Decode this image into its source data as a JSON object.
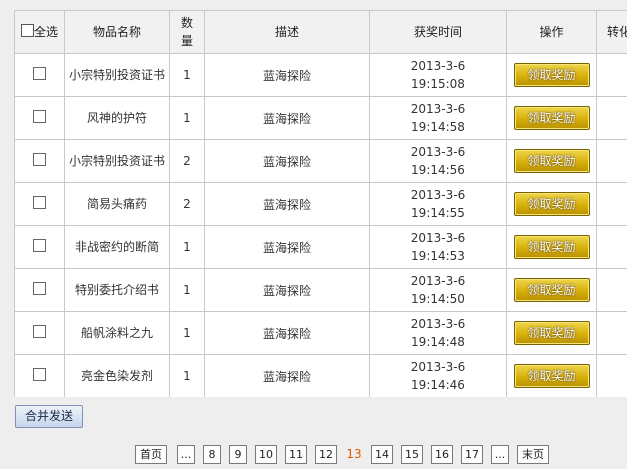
{
  "table": {
    "headers": {
      "select_all": "全选",
      "name": "物品名称",
      "quantity": "数量",
      "description": "描述",
      "time": "获奖时间",
      "action": "操作",
      "transfer": "转化成"
    },
    "rows": [
      {
        "name": "小宗特别投资证书",
        "qty": "1",
        "desc": "蓝海探险",
        "date": "2013-3-6",
        "time": "19:15:08",
        "action": "领取奖励"
      },
      {
        "name": "风神的护符",
        "qty": "1",
        "desc": "蓝海探险",
        "date": "2013-3-6",
        "time": "19:14:58",
        "action": "领取奖励"
      },
      {
        "name": "小宗特别投资证书",
        "qty": "2",
        "desc": "蓝海探险",
        "date": "2013-3-6",
        "time": "19:14:56",
        "action": "领取奖励"
      },
      {
        "name": "简易头痛药",
        "qty": "2",
        "desc": "蓝海探险",
        "date": "2013-3-6",
        "time": "19:14:55",
        "action": "领取奖励"
      },
      {
        "name": "非战密约的断简",
        "qty": "1",
        "desc": "蓝海探险",
        "date": "2013-3-6",
        "time": "19:14:53",
        "action": "领取奖励"
      },
      {
        "name": "特别委托介绍书",
        "qty": "1",
        "desc": "蓝海探险",
        "date": "2013-3-6",
        "time": "19:14:50",
        "action": "领取奖励"
      },
      {
        "name": "船帆涂料之九",
        "qty": "1",
        "desc": "蓝海探险",
        "date": "2013-3-6",
        "time": "19:14:48",
        "action": "领取奖励"
      },
      {
        "name": "亮金色染发剂",
        "qty": "1",
        "desc": "蓝海探险",
        "date": "2013-3-6",
        "time": "19:14:46",
        "action": "领取奖励"
      }
    ]
  },
  "merge_button": "合并发送",
  "pagination": {
    "first": "首页",
    "ellipsis_left": "...",
    "pages": [
      "8",
      "9",
      "10",
      "11",
      "12"
    ],
    "current": "13",
    "pages_after": [
      "14",
      "15",
      "16",
      "17"
    ],
    "ellipsis_right": "...",
    "last": "末页"
  },
  "colors": {
    "claim_button": "#d7b00b",
    "current_page": "#e05a00",
    "merge_button": "#c7d5ea"
  }
}
